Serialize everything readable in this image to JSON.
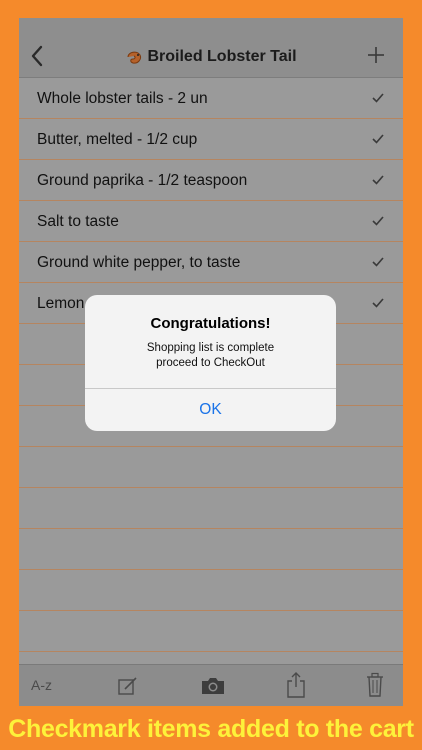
{
  "nav": {
    "title": "Broiled Lobster Tail"
  },
  "items": [
    {
      "label": "Whole lobster tails - 2 un",
      "checked": true
    },
    {
      "label": "Butter, melted  - 1/2 cup",
      "checked": true
    },
    {
      "label": "Ground paprika - 1/2 teaspoon",
      "checked": true
    },
    {
      "label": "Salt to taste",
      "checked": true
    },
    {
      "label": "Ground white pepper, to taste",
      "checked": true
    },
    {
      "label": "Lemon",
      "checked": true
    },
    {
      "label": "",
      "checked": false
    },
    {
      "label": "",
      "checked": false
    },
    {
      "label": "",
      "checked": false
    },
    {
      "label": "",
      "checked": false
    },
    {
      "label": "",
      "checked": false
    },
    {
      "label": "",
      "checked": false
    },
    {
      "label": "",
      "checked": false
    },
    {
      "label": "",
      "checked": false
    },
    {
      "label": "",
      "checked": false
    }
  ],
  "toolbar": {
    "sort_label": "A-z"
  },
  "alert": {
    "title": "Congratulations!",
    "message_line1": "Shopping list is complete",
    "message_line2": "proceed to CheckOut",
    "ok_label": "OK"
  },
  "banner": "Checkmark items added to the cart",
  "colors": {
    "background": "#f58a2b",
    "banner_text": "#fdf23a",
    "link_blue": "#1a73e8"
  }
}
